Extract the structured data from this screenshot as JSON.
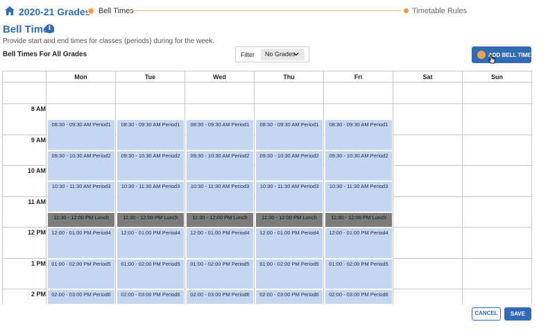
{
  "header": {
    "title": "2020-21 Grades",
    "steps": [
      {
        "label": "Bell Times",
        "active": true
      },
      {
        "label": "Timetable Rules",
        "active": false
      }
    ]
  },
  "page": {
    "title": "Bell Times",
    "subtitle": "Provide start and end times for classes (periods) during for the week.",
    "section_title": "Bell Times For All Grades"
  },
  "filter": {
    "label": "Filter",
    "value": "No Grades"
  },
  "add_button": {
    "label": "ADD BELL TIME"
  },
  "calendar": {
    "days": [
      "Mon",
      "Tue",
      "Wed",
      "Thu",
      "Fri",
      "Sat",
      "Sun"
    ],
    "hours": [
      "8 AM",
      "9 AM",
      "10 AM",
      "11 AM",
      "12 PM",
      "1 PM",
      "2 PM"
    ],
    "events": [
      {
        "label": "08:30 - 09:30 AM Period1",
        "type": "period"
      },
      {
        "label": "09:30 - 10:30 AM Period2",
        "type": "period"
      },
      {
        "label": "10:30 - 11:30 AM Period3",
        "type": "period"
      },
      {
        "label": "11:30 - 12:00 PM Lunch",
        "type": "lunch"
      },
      {
        "label": "12:00 - 01:00 PM Period4",
        "type": "period"
      },
      {
        "label": "01:00 - 02:00 PM Period5",
        "type": "period"
      },
      {
        "label": "02:00 - 03:00 PM Period6",
        "type": "period"
      }
    ],
    "event_days": [
      "Mon",
      "Tue",
      "Wed",
      "Thu",
      "Fri"
    ]
  },
  "footer": {
    "cancel_label": "CANCEL",
    "save_label": "SAVE"
  },
  "colors": {
    "accent": "#2f6cb5",
    "period": "#c5d6f1",
    "lunch": "#7c7c7c",
    "step": "#ec9a3f"
  }
}
